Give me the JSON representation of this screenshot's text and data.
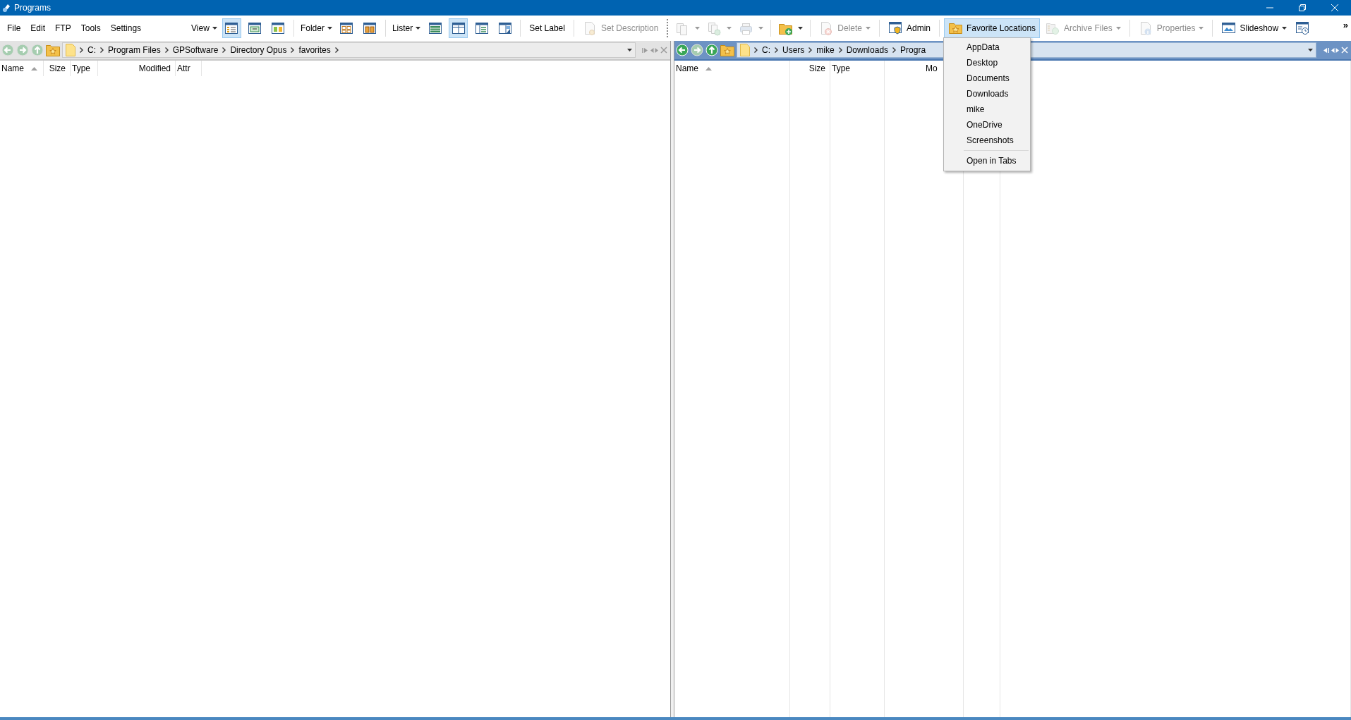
{
  "window": {
    "title": "Programs"
  },
  "menu_bar": [
    {
      "label": "File"
    },
    {
      "label": "Edit"
    },
    {
      "label": "FTP"
    },
    {
      "label": "Tools"
    },
    {
      "label": "Settings"
    }
  ],
  "toolbar": [
    {
      "kind": "dropdown",
      "label": "View"
    },
    {
      "kind": "toggle",
      "selected": true
    },
    {
      "kind": "toggle",
      "selected": false
    },
    {
      "kind": "toggle",
      "selected": false
    },
    {
      "kind": "separator"
    },
    {
      "kind": "dropdown",
      "label": "Folder"
    },
    {
      "kind": "toggle",
      "selected": false
    },
    {
      "kind": "toggle",
      "selected": false
    },
    {
      "kind": "separator"
    },
    {
      "kind": "dropdown",
      "label": "Lister"
    },
    {
      "kind": "toggle",
      "selected": false
    },
    {
      "kind": "toggle",
      "selected": true
    },
    {
      "kind": "toggle",
      "selected": false
    },
    {
      "kind": "toggle",
      "selected": false
    },
    {
      "kind": "separator"
    },
    {
      "kind": "button",
      "label": "Set Label",
      "disabled": false,
      "selected": false
    },
    {
      "kind": "separator"
    },
    {
      "kind": "button",
      "label": "Set Description",
      "disabled": true,
      "selected": false
    },
    {
      "kind": "grip"
    },
    {
      "kind": "icon-button",
      "disabled": true,
      "has_menu": true
    },
    {
      "kind": "icon-button",
      "disabled": true,
      "has_menu": true
    },
    {
      "kind": "icon-button",
      "disabled": true,
      "has_menu": true
    },
    {
      "kind": "separator"
    },
    {
      "kind": "icon-button",
      "disabled": false,
      "has_menu": true
    },
    {
      "kind": "separator"
    },
    {
      "kind": "button",
      "label": "Delete",
      "disabled": true,
      "selected": false,
      "has_menu": true
    },
    {
      "kind": "separator"
    },
    {
      "kind": "button",
      "label": "Admin",
      "disabled": false,
      "selected": false
    },
    {
      "kind": "separator"
    },
    {
      "kind": "button",
      "label": "Favorite Locations",
      "disabled": false,
      "selected": true
    },
    {
      "kind": "button",
      "label": "Archive Files",
      "disabled": true,
      "selected": false,
      "has_menu": true
    },
    {
      "kind": "separator"
    },
    {
      "kind": "button",
      "label": "Properties",
      "disabled": true,
      "selected": false,
      "has_menu": true
    },
    {
      "kind": "separator"
    },
    {
      "kind": "button",
      "label": "Slideshow",
      "disabled": false,
      "selected": false,
      "has_menu": true
    },
    {
      "kind": "icon-button",
      "disabled": false
    },
    {
      "kind": "overflow",
      "label": "»"
    }
  ],
  "favorites_menu": {
    "items": [
      {
        "label": "AppData"
      },
      {
        "label": "Desktop"
      },
      {
        "label": "Documents"
      },
      {
        "label": "Downloads"
      },
      {
        "label": "mike"
      },
      {
        "label": "OneDrive"
      },
      {
        "label": "Screenshots"
      }
    ],
    "footer": [
      {
        "label": "Open in Tabs"
      }
    ]
  },
  "panes": [
    {
      "active": false,
      "forward_enabled": true,
      "trailing_separator": true,
      "path": [
        "C:",
        "Program Files",
        "GPSoftware",
        "Directory Opus",
        "favorites"
      ],
      "columns": [
        {
          "label": "Name",
          "sorted_ascending": true
        },
        {
          "label": "Size",
          "sorted_ascending": false
        },
        {
          "label": "Type",
          "sorted_ascending": false
        },
        {
          "label": "Modified",
          "sorted_ascending": false
        },
        {
          "label": "Attr",
          "sorted_ascending": false
        }
      ]
    },
    {
      "active": true,
      "gridlines": true,
      "forward_enabled": false,
      "path": [
        "C:",
        "Users",
        "mike",
        "Downloads",
        "Progra"
      ],
      "columns": [
        {
          "label": "Name",
          "sorted_ascending": true
        },
        {
          "label": "Size",
          "sorted_ascending": false
        },
        {
          "label": "Type",
          "sorted_ascending": false
        },
        {
          "label": "Mo",
          "sorted_ascending": false
        }
      ]
    }
  ]
}
